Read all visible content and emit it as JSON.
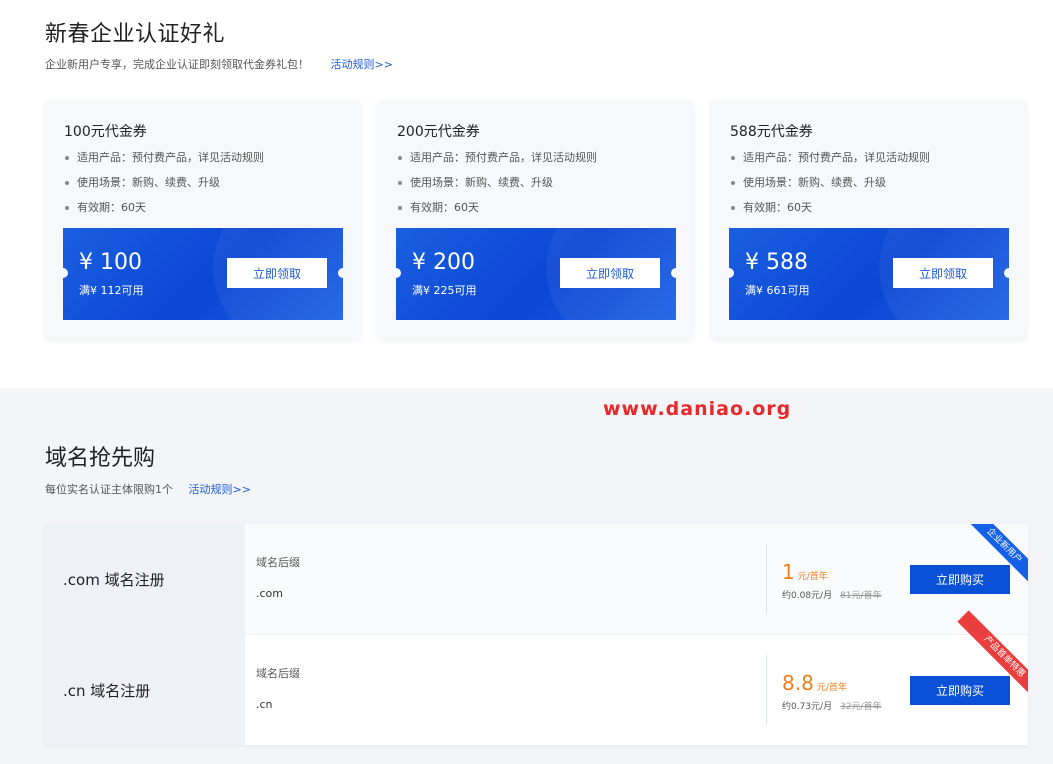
{
  "promo": {
    "title": "新春企业认证好礼",
    "subtitle": "企业新用户专享，完成企业认证即刻领取代金券礼包！",
    "rules_link": "活动规则>>",
    "vouchers": [
      {
        "title": "100元代金券",
        "items": [
          "适用产品：预付费产品，详见活动规则",
          "使用场景：新购、续费、升级",
          "有效期：60天"
        ],
        "amount": "¥ 100",
        "condition": "满¥ 112可用",
        "button": "立即领取"
      },
      {
        "title": "200元代金券",
        "items": [
          "适用产品：预付费产品，详见活动规则",
          "使用场景：新购、续费、升级",
          "有效期：60天"
        ],
        "amount": "¥ 200",
        "condition": "满¥ 225可用",
        "button": "立即领取"
      },
      {
        "title": "588元代金券",
        "items": [
          "适用产品：预付费产品，详见活动规则",
          "使用场景：新购、续费、升级",
          "有效期：60天"
        ],
        "amount": "¥ 588",
        "condition": "满¥ 661可用",
        "button": "立即领取"
      }
    ]
  },
  "watermark": "www.daniao.org",
  "domain": {
    "title": "域名抢先购",
    "subtitle": "每位实名认证主体限购1个",
    "rules_link": "活动规则>>",
    "rows": [
      {
        "name": ".com 域名注册",
        "suffix_label": "域名后缀",
        "suffix": ".com",
        "price": "1",
        "price_unit": "元/首年",
        "per_month": "约0.08元/月",
        "original": "81元/首年",
        "button": "立即购买",
        "badge": "企业新用户",
        "badge_color": "#1560e8"
      },
      {
        "name": ".cn 域名注册",
        "suffix_label": "域名后缀",
        "suffix": ".cn",
        "price": "8.8",
        "price_unit": "元/首年",
        "per_month": "约0.73元/月",
        "original": "32元/首年",
        "button": "立即购买",
        "badge": "产品首单特惠",
        "badge_color": "#ea3d3d"
      }
    ]
  },
  "colors": {
    "accent": "#0b51d8",
    "price": "#f07d1a",
    "watermark": "#e8282a"
  }
}
